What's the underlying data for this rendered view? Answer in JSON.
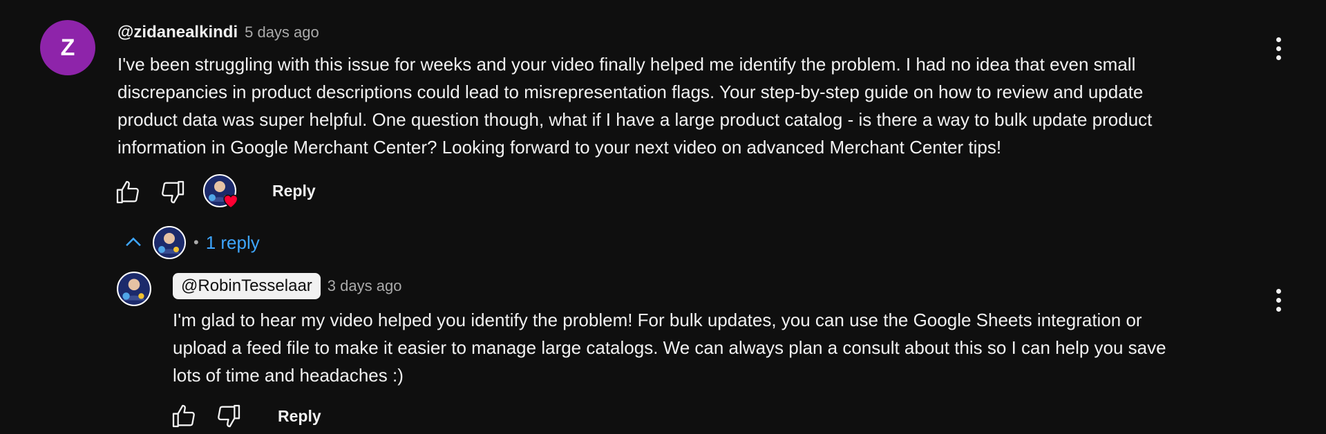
{
  "comment": {
    "avatar_letter": "Z",
    "avatar_color": "#8e24aa",
    "author": "@zidanealkindi",
    "time": "5 days ago",
    "lines": [
      "I've been struggling with this issue for weeks and your video finally helped me identify the problem. I had no idea that even small",
      "discrepancies in product descriptions could lead to misrepresentation flags. Your step-by-step guide on how to review and update",
      "product data was super helpful. One question though, what if I have a large product catalog - is there a way to bulk update product",
      "information in Google Merchant Center? Looking forward to your next video on advanced Merchant Center tips!"
    ],
    "reply_label": "Reply",
    "like_icon": "thumb-up-icon",
    "dislike_icon": "thumb-down-icon",
    "creator_heart_icon": "creator-heart-icon",
    "more_icon": "more-vert-icon"
  },
  "replies_toggle": {
    "icon": "chevron-up-icon",
    "separator": "•",
    "label": "1 reply",
    "color": "#3ea6ff"
  },
  "reply": {
    "author": "@RobinTesselaar",
    "time": "3 days ago",
    "lines": [
      "I'm glad to hear my video helped you identify the problem! For bulk updates, you can use the Google Sheets integration or",
      "upload a feed file to make it easier to manage large catalogs. We can always plan a consult about this so I can help you save",
      "lots of time and headaches :)"
    ],
    "reply_label": "Reply",
    "like_icon": "thumb-up-icon",
    "dislike_icon": "thumb-down-icon",
    "more_icon": "more-vert-icon"
  }
}
